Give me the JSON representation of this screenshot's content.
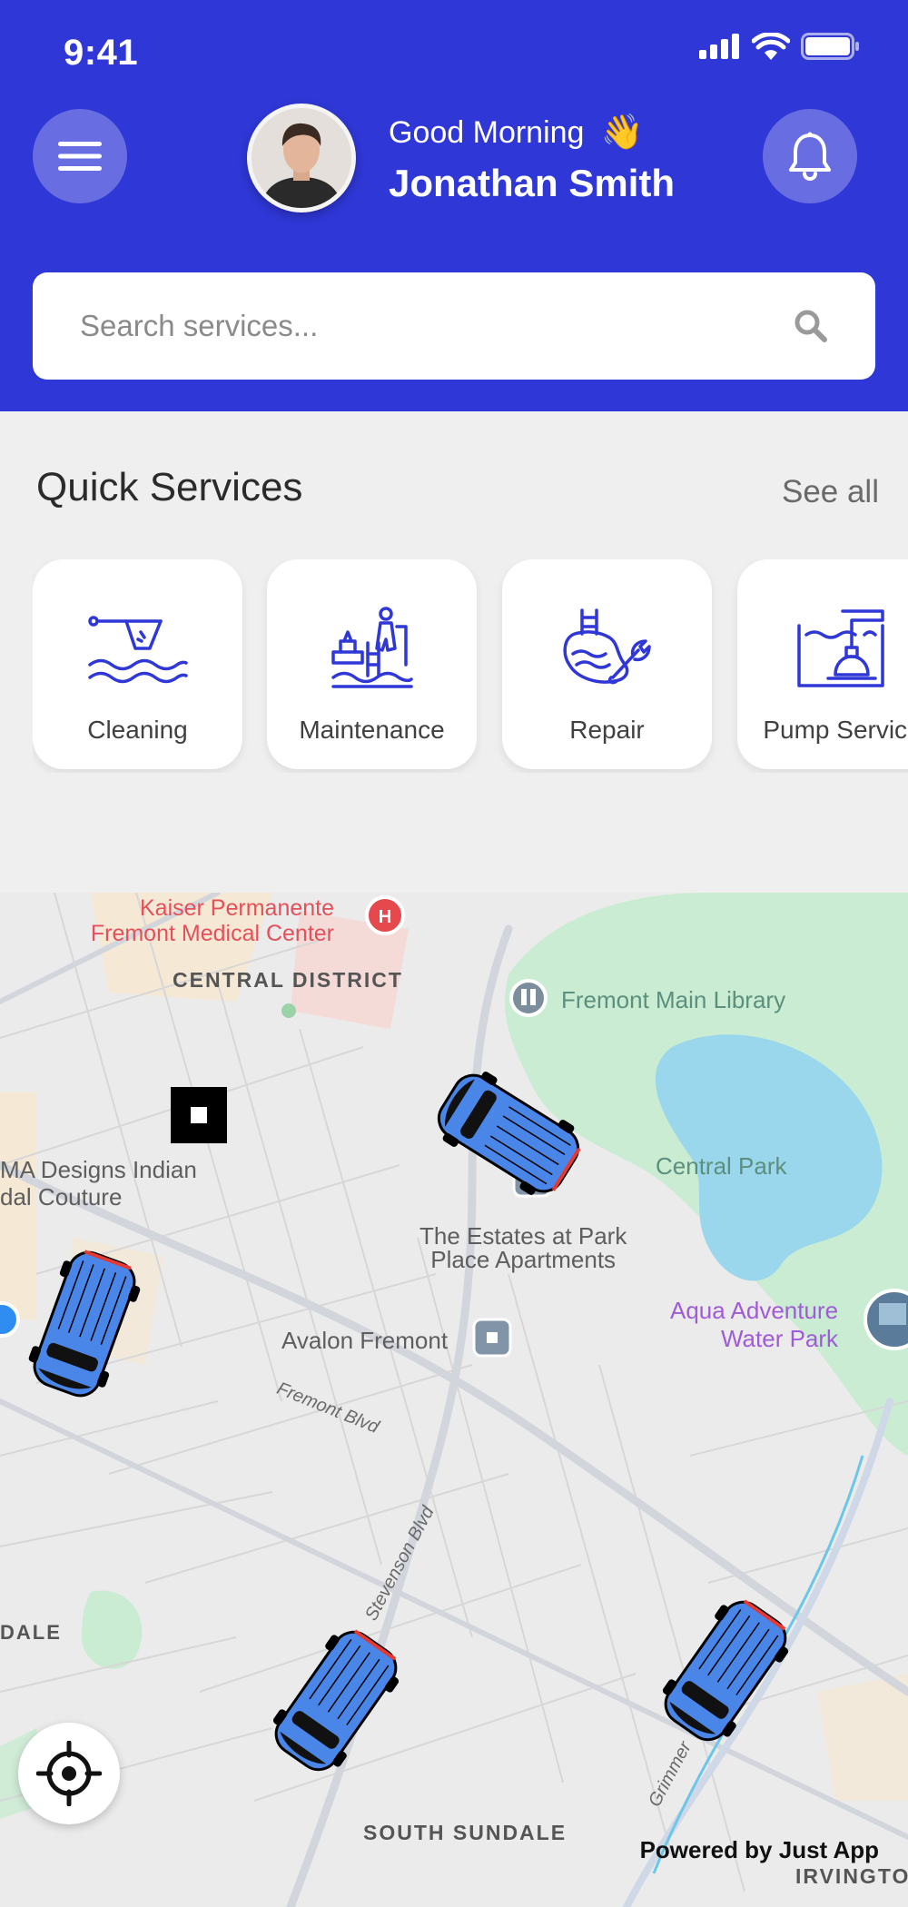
{
  "status_bar": {
    "time": "9:41"
  },
  "header": {
    "greeting": "Good Morning",
    "greeting_emoji": "👋",
    "user_name": "Jonathan Smith"
  },
  "search": {
    "placeholder": "Search services..."
  },
  "quick_services": {
    "title": "Quick Services",
    "see_all": "See all",
    "items": [
      {
        "label": "Cleaning",
        "icon": "pool-cleaning-icon"
      },
      {
        "label": "Maintenance",
        "icon": "pool-maintenance-icon"
      },
      {
        "label": "Repair",
        "icon": "pool-repair-icon"
      },
      {
        "label": "Pump Service",
        "icon": "pool-pump-icon"
      }
    ]
  },
  "map": {
    "labels": {
      "kaiser_1": "Kaiser Permanente",
      "kaiser_2": "Fremont Medical Center",
      "central_district": "CENTRAL DISTRICT",
      "library": "Fremont Main Library",
      "central_park": "Central Park",
      "ma_designs_1": "MA Designs Indian",
      "ma_designs_2": "dal Couture",
      "estates_1": "The Estates at Park",
      "estates_2": "Place Apartments",
      "avalon": "Avalon Fremont",
      "fremont_blvd": "Fremont Blvd",
      "aqua_1": "Aqua Adventure",
      "aqua_2": "Water Park",
      "stevenson_blvd": "Stevenson Blvd",
      "dale": "DALE",
      "grimmer": "Grimmer",
      "south_sundale": "SOUTH SUNDALE",
      "irvington": "IRVINGTO"
    },
    "vehicle_count": 4
  },
  "footer": {
    "powered_by": "Powered by Just App"
  },
  "colors": {
    "primary": "#2f37d6",
    "vehicle": "#4a86e8",
    "park": "#c9ecd2",
    "water": "#9ad7ec"
  }
}
